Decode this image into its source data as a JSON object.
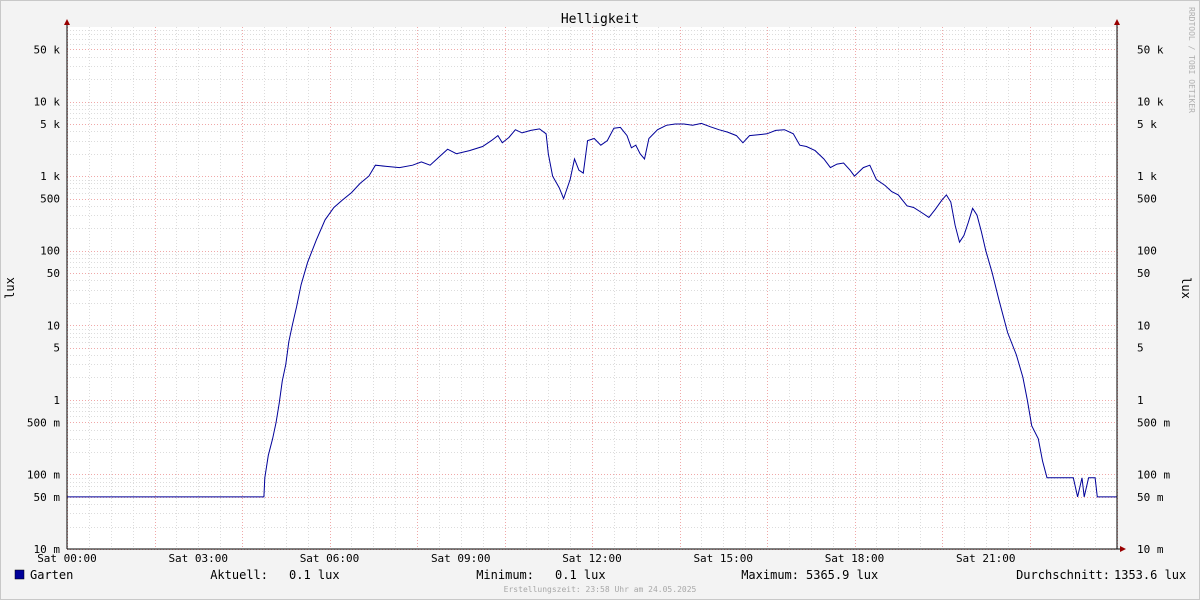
{
  "chart_data": {
    "type": "line",
    "title": "Helligkeit",
    "ylabel": "lux",
    "yscale": "log",
    "ylim": [
      0.01,
      100000
    ],
    "xlim_hours": [
      0,
      24
    ],
    "grid": true,
    "y_ticks": [
      {
        "value": 0.01,
        "label": "10 m"
      },
      {
        "value": 0.05,
        "label": "50 m"
      },
      {
        "value": 0.1,
        "label": "100 m"
      },
      {
        "value": 0.5,
        "label": "500 m"
      },
      {
        "value": 1,
        "label": "1"
      },
      {
        "value": 5,
        "label": "5"
      },
      {
        "value": 10,
        "label": "10"
      },
      {
        "value": 50,
        "label": "50"
      },
      {
        "value": 100,
        "label": "100"
      },
      {
        "value": 500,
        "label": "500"
      },
      {
        "value": 1000,
        "label": "1 k"
      },
      {
        "value": 5000,
        "label": "5 k"
      },
      {
        "value": 10000,
        "label": "10 k"
      },
      {
        "value": 50000,
        "label": "50 k"
      }
    ],
    "x_ticks": [
      {
        "hour": 0,
        "label": "Sat 00:00"
      },
      {
        "hour": 3,
        "label": "Sat 03:00"
      },
      {
        "hour": 6,
        "label": "Sat 06:00"
      },
      {
        "hour": 9,
        "label": "Sat 09:00"
      },
      {
        "hour": 12,
        "label": "Sat 12:00"
      },
      {
        "hour": 15,
        "label": "Sat 15:00"
      },
      {
        "hour": 18,
        "label": "Sat 18:00"
      },
      {
        "hour": 21,
        "label": "Sat 21:00"
      }
    ],
    "series": [
      {
        "name": "Garten",
        "color": "#000099",
        "points": [
          [
            0,
            0.05
          ],
          [
            4.5,
            0.05
          ],
          [
            4.52,
            0.09
          ],
          [
            4.6,
            0.18
          ],
          [
            4.7,
            0.3
          ],
          [
            4.78,
            0.5
          ],
          [
            4.85,
            0.9
          ],
          [
            4.92,
            1.8
          ],
          [
            5.0,
            3
          ],
          [
            5.07,
            6
          ],
          [
            5.15,
            10
          ],
          [
            5.25,
            18
          ],
          [
            5.35,
            35
          ],
          [
            5.5,
            70
          ],
          [
            5.7,
            140
          ],
          [
            5.9,
            260
          ],
          [
            6.1,
            380
          ],
          [
            6.3,
            480
          ],
          [
            6.5,
            600
          ],
          [
            6.7,
            800
          ],
          [
            6.9,
            1000
          ],
          [
            7.05,
            1400
          ],
          [
            7.3,
            1350
          ],
          [
            7.6,
            1300
          ],
          [
            7.9,
            1400
          ],
          [
            8.1,
            1550
          ],
          [
            8.3,
            1400
          ],
          [
            8.5,
            1800
          ],
          [
            8.7,
            2300
          ],
          [
            8.9,
            2000
          ],
          [
            9.2,
            2200
          ],
          [
            9.5,
            2500
          ],
          [
            9.7,
            3000
          ],
          [
            9.85,
            3500
          ],
          [
            9.95,
            2800
          ],
          [
            10.1,
            3300
          ],
          [
            10.25,
            4200
          ],
          [
            10.4,
            3800
          ],
          [
            10.6,
            4100
          ],
          [
            10.8,
            4300
          ],
          [
            10.95,
            3700
          ],
          [
            11.0,
            2000
          ],
          [
            11.1,
            1000
          ],
          [
            11.25,
            700
          ],
          [
            11.35,
            500
          ],
          [
            11.5,
            900
          ],
          [
            11.6,
            1700
          ],
          [
            11.7,
            1200
          ],
          [
            11.8,
            1100
          ],
          [
            11.9,
            3000
          ],
          [
            12.05,
            3200
          ],
          [
            12.2,
            2600
          ],
          [
            12.35,
            3000
          ],
          [
            12.5,
            4400
          ],
          [
            12.65,
            4500
          ],
          [
            12.8,
            3500
          ],
          [
            12.9,
            2400
          ],
          [
            13.0,
            2600
          ],
          [
            13.1,
            2000
          ],
          [
            13.2,
            1700
          ],
          [
            13.3,
            3200
          ],
          [
            13.5,
            4200
          ],
          [
            13.7,
            4800
          ],
          [
            13.9,
            5000
          ],
          [
            14.1,
            5000
          ],
          [
            14.3,
            4800
          ],
          [
            14.5,
            5100
          ],
          [
            14.7,
            4600
          ],
          [
            14.9,
            4200
          ],
          [
            15.1,
            3900
          ],
          [
            15.3,
            3500
          ],
          [
            15.45,
            2800
          ],
          [
            15.6,
            3500
          ],
          [
            15.8,
            3600
          ],
          [
            16.0,
            3700
          ],
          [
            16.2,
            4100
          ],
          [
            16.4,
            4200
          ],
          [
            16.6,
            3700
          ],
          [
            16.75,
            2600
          ],
          [
            16.9,
            2500
          ],
          [
            17.1,
            2200
          ],
          [
            17.3,
            1700
          ],
          [
            17.45,
            1300
          ],
          [
            17.6,
            1450
          ],
          [
            17.75,
            1500
          ],
          [
            17.9,
            1200
          ],
          [
            18.0,
            1000
          ],
          [
            18.2,
            1300
          ],
          [
            18.35,
            1400
          ],
          [
            18.5,
            900
          ],
          [
            18.7,
            750
          ],
          [
            18.85,
            620
          ],
          [
            19.0,
            560
          ],
          [
            19.2,
            400
          ],
          [
            19.35,
            380
          ],
          [
            19.55,
            320
          ],
          [
            19.7,
            280
          ],
          [
            19.85,
            360
          ],
          [
            20.0,
            480
          ],
          [
            20.1,
            560
          ],
          [
            20.2,
            450
          ],
          [
            20.3,
            220
          ],
          [
            20.4,
            130
          ],
          [
            20.5,
            160
          ],
          [
            20.6,
            240
          ],
          [
            20.7,
            370
          ],
          [
            20.8,
            300
          ],
          [
            20.9,
            180
          ],
          [
            21.0,
            100
          ],
          [
            21.15,
            50
          ],
          [
            21.3,
            22
          ],
          [
            21.5,
            8
          ],
          [
            21.7,
            4
          ],
          [
            21.85,
            2
          ],
          [
            21.95,
            1
          ],
          [
            22.05,
            0.45
          ],
          [
            22.2,
            0.3
          ],
          [
            22.3,
            0.15
          ],
          [
            22.4,
            0.09
          ],
          [
            22.6,
            0.09
          ],
          [
            22.8,
            0.09
          ],
          [
            23.0,
            0.09
          ],
          [
            23.1,
            0.05
          ],
          [
            23.2,
            0.09
          ],
          [
            23.25,
            0.05
          ],
          [
            23.35,
            0.09
          ],
          [
            23.5,
            0.09
          ],
          [
            23.55,
            0.05
          ],
          [
            24.0,
            0.05
          ]
        ]
      }
    ],
    "legend": [
      {
        "label": "Aktuell:",
        "value": "0.1 lux"
      },
      {
        "label": "Minimum:",
        "value": "0.1 lux"
      },
      {
        "label": "Maximum:",
        "value": "5365.9 lux"
      },
      {
        "label": "Durchschnitt:",
        "value": "1353.6 lux"
      }
    ],
    "watermark": "RRDTOOL / TOBI OETIKER",
    "footer": "Erstellungszeit: 23:58 Uhr am 24.05.2025"
  }
}
